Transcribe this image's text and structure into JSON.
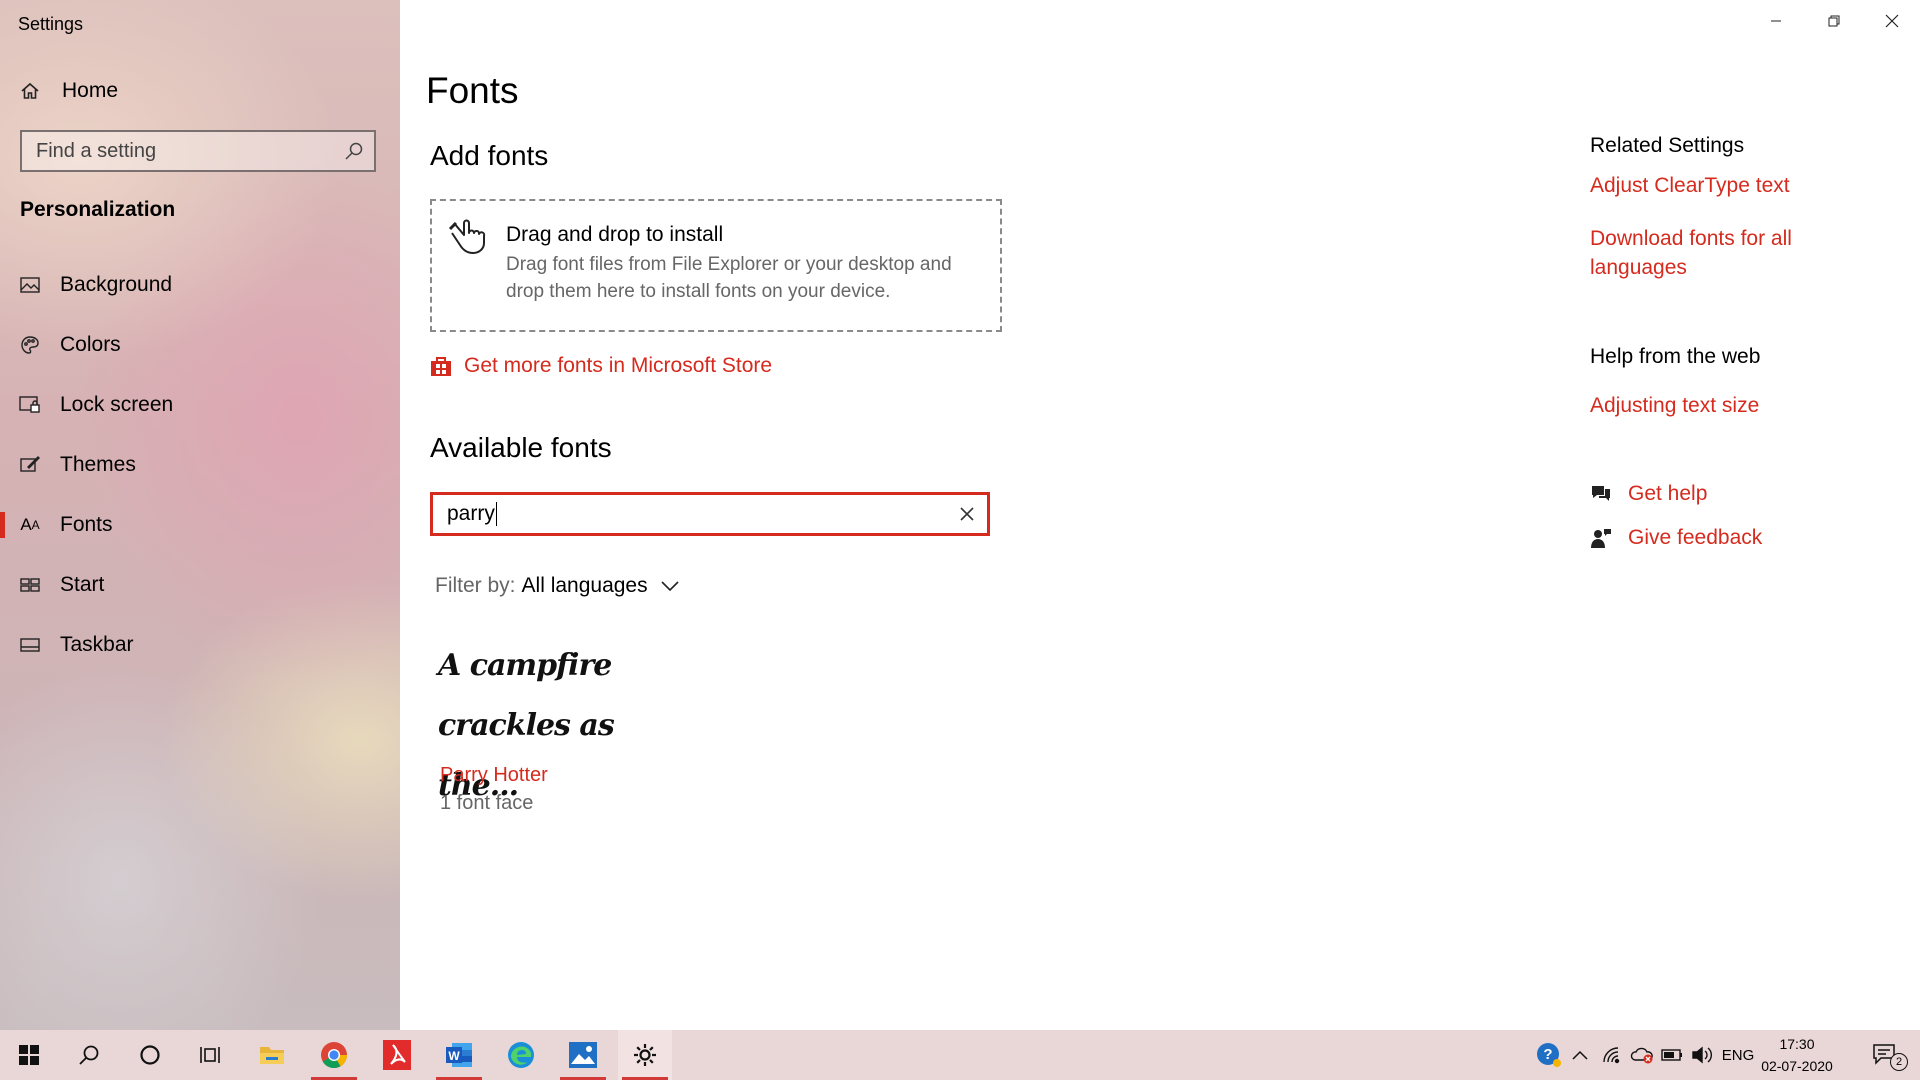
{
  "app": {
    "title": "Settings"
  },
  "sidebar": {
    "home_label": "Home",
    "search_placeholder": "Find a setting",
    "section_title": "Personalization",
    "items": [
      {
        "label": "Background",
        "icon": "picture-icon"
      },
      {
        "label": "Colors",
        "icon": "palette-icon"
      },
      {
        "label": "Lock screen",
        "icon": "lock-screen-icon"
      },
      {
        "label": "Themes",
        "icon": "brush-icon"
      },
      {
        "label": "Fonts",
        "icon": "font-icon",
        "active": true
      },
      {
        "label": "Start",
        "icon": "start-icon"
      },
      {
        "label": "Taskbar",
        "icon": "taskbar-icon"
      }
    ]
  },
  "main": {
    "title": "Fonts",
    "add_fonts": {
      "heading": "Add fonts",
      "drop_title": "Drag and drop to install",
      "drop_desc": "Drag font files from File Explorer or your desktop and drop them here to install fonts on your device.",
      "store_link": "Get more fonts in Microsoft Store"
    },
    "available": {
      "heading": "Available fonts",
      "search_value": "parry",
      "filter_label": "Filter by:",
      "filter_value": "All languages",
      "fonts": [
        {
          "preview_line1": "A campfire",
          "preview_line2": "crackles as the...",
          "name": "Parry Hotter",
          "faces": "1 font face"
        }
      ]
    }
  },
  "related": {
    "heading": "Related Settings",
    "links": [
      "Adjust ClearType text",
      "Download fonts for all",
      "languages"
    ],
    "help_heading": "Help from the web",
    "help_link": "Adjusting text size",
    "get_help": "Get help",
    "give_feedback": "Give feedback"
  },
  "taskbar": {
    "apps": [
      "start-icon",
      "search-icon",
      "cortana-icon",
      "task-view-icon",
      "file-explorer-icon",
      "chrome-icon",
      "acrobat-icon",
      "word-icon",
      "edge-icon",
      "photos-icon",
      "settings-icon"
    ],
    "language": "ENG",
    "time": "17:30",
    "date": "02-07-2020",
    "notification_count": "2"
  },
  "colors": {
    "accent": "#d52b1e",
    "taskbar": "#e9d6d6"
  }
}
